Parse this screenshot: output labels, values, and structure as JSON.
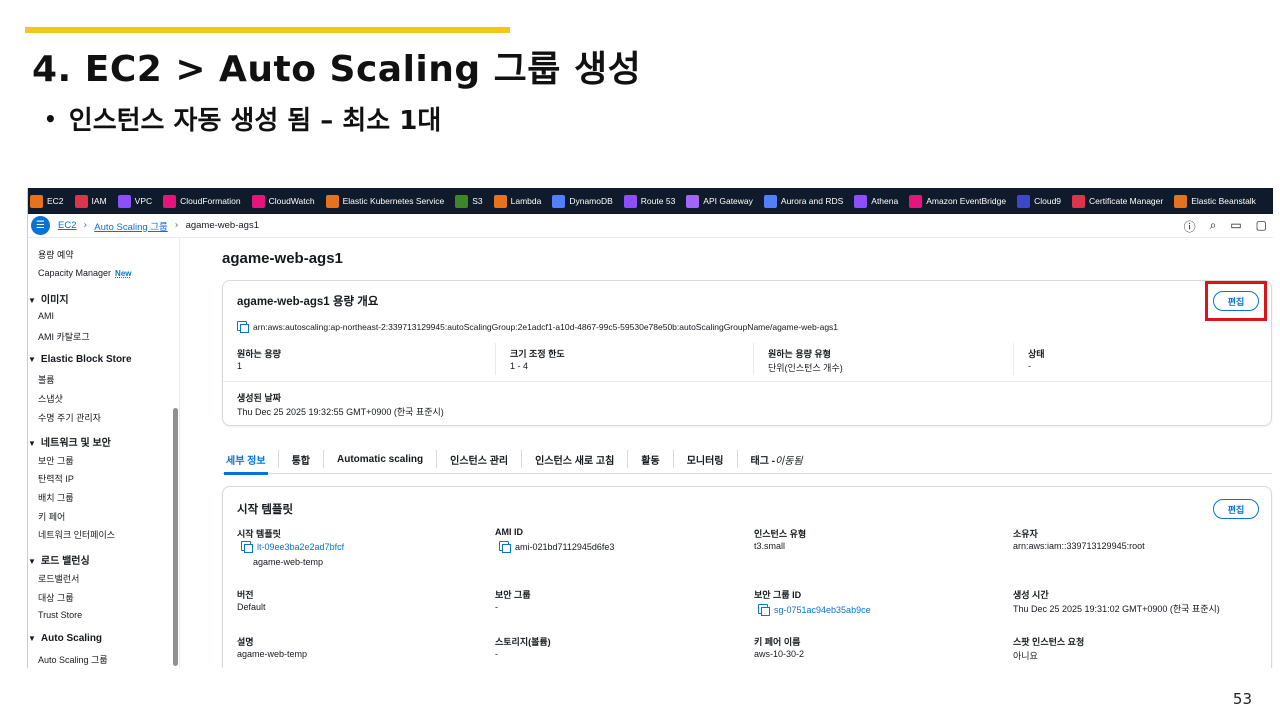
{
  "slide": {
    "title": "4. EC2 > Auto Scaling 그룹 생성",
    "bullet": "인스턴스 자동 생성 됨 – 최소 1대",
    "page_number": "53"
  },
  "colors": {
    "accent": "#f5c518",
    "link": "#0972d3",
    "highlight_box": "#d91515",
    "topbar": "#0f1b2a"
  },
  "service_bar": [
    {
      "label": "EC2",
      "color": "#e8711a",
      "icon": "ec2-icon"
    },
    {
      "label": "IAM",
      "color": "#dd344c",
      "icon": "iam-icon"
    },
    {
      "label": "VPC",
      "color": "#8c4fff",
      "icon": "vpc-icon"
    },
    {
      "label": "CloudFormation",
      "color": "#e7157b",
      "icon": "cloudformation-icon"
    },
    {
      "label": "CloudWatch",
      "color": "#e7157b",
      "icon": "cloudwatch-icon"
    },
    {
      "label": "Elastic Kubernetes Service",
      "color": "#e8711a",
      "icon": "eks-icon"
    },
    {
      "label": "S3",
      "color": "#3f8624",
      "icon": "s3-icon"
    },
    {
      "label": "Lambda",
      "color": "#e8711a",
      "icon": "lambda-icon"
    },
    {
      "label": "DynamoDB",
      "color": "#527fff",
      "icon": "dynamodb-icon"
    },
    {
      "label": "Route 53",
      "color": "#8c4fff",
      "icon": "route53-icon"
    },
    {
      "label": "API Gateway",
      "color": "#a166ff",
      "icon": "api-gateway-icon"
    },
    {
      "label": "Aurora and RDS",
      "color": "#527fff",
      "icon": "rds-icon"
    },
    {
      "label": "Athena",
      "color": "#8c4fff",
      "icon": "athena-icon"
    },
    {
      "label": "Amazon EventBridge",
      "color": "#e7157b",
      "icon": "eventbridge-icon"
    },
    {
      "label": "Cloud9",
      "color": "#3b48cc",
      "icon": "cloud9-icon"
    },
    {
      "label": "Certificate Manager",
      "color": "#dd344c",
      "icon": "acm-icon"
    },
    {
      "label": "Elastic Beanstalk",
      "color": "#e8711a",
      "icon": "beanstalk-icon"
    }
  ],
  "breadcrumb": {
    "root": "EC2",
    "parent": "Auto Scaling 그룹",
    "current": "agame-web-ags1"
  },
  "sidebar": {
    "capacity_reservation": "용량 예약",
    "capacity_manager": "Capacity Manager",
    "new_badge": "New",
    "images_head": "이미지",
    "ami": "AMI",
    "ami_catalog": "AMI 카탈로그",
    "ebs_head": "Elastic Block Store",
    "volumes": "볼륨",
    "snapshots": "스냅샷",
    "lifecycle": "수명 주기 관리자",
    "network_head": "네트워크 및 보안",
    "security_groups": "보안 그룹",
    "elastic_ip": "탄력적 IP",
    "placement_groups": "배치 그룹",
    "key_pairs": "키 페어",
    "network_interfaces": "네트워크 인터페이스",
    "lb_head": "로드 밸런싱",
    "load_balancers": "로드밸런서",
    "target_groups": "대상 그룹",
    "trust_store": "Trust Store",
    "as_head": "Auto Scaling",
    "as_groups": "Auto Scaling 그룹"
  },
  "main": {
    "heading": "agame-web-ags1",
    "overview": {
      "title": "agame-web-ags1 용량 개요",
      "edit": "편집",
      "arn": "arn:aws:autoscaling:ap-northeast-2:339713129945:autoScalingGroup:2e1adcf1-a10d-4867-99c5-59530e78e50b:autoScalingGroupName/agame-web-ags1",
      "desired_label": "원하는 용량",
      "desired_value": "1",
      "limits_label": "크기 조정 한도",
      "limits_value": "1 - 4",
      "type_label": "원하는 용량 유형",
      "type_value": "단위(인스턴스 개수)",
      "status_label": "상태",
      "status_value": "-",
      "created_label": "생성된 날짜",
      "created_value": "Thu Dec 25 2025 19:32:55 GMT+0900 (한국 표준시)"
    },
    "tabs": {
      "details": "세부 정보",
      "integrations": "통합",
      "automatic_scaling": "Automatic scaling",
      "instance_management": "인스턴스 관리",
      "instance_refresh": "인스턴스 새로 고침",
      "activity": "활동",
      "monitoring": "모니터링",
      "tags": "태그 - ",
      "tags_moved": "이동됨"
    },
    "launch_template": {
      "title": "시작 템플릿",
      "edit": "편집",
      "lt_label": "시작 템플릿",
      "lt_id": "lt-09ee3ba2e2ad7bfcf",
      "lt_name": "agame-web-temp",
      "ami_label": "AMI ID",
      "ami_value": "ami-021bd7112945d6fe3",
      "instance_type_label": "인스턴스 유형",
      "instance_type_value": "t3.small",
      "owner_label": "소유자",
      "owner_value": "arn:aws:iam::339713129945:root",
      "version_label": "버전",
      "version_value": "Default",
      "sg_label": "보안 그룹",
      "sg_value": "-",
      "sg_id_label": "보안 그룹 ID",
      "sg_id_value": "sg-0751ac94eb35ab9ce",
      "created_time_label": "생성 시간",
      "created_time_value": "Thu Dec 25 2025 19:31:02 GMT+0900 (한국 표준시)",
      "desc_label": "설명",
      "desc_value": "agame-web-temp",
      "storage_label": "스토리지(볼륨)",
      "storage_value": "-",
      "key_label": "키 페어 이름",
      "key_value": "aws-10-30-2",
      "spot_label": "스팟 인스턴스 요청",
      "spot_value": "아니요"
    }
  }
}
